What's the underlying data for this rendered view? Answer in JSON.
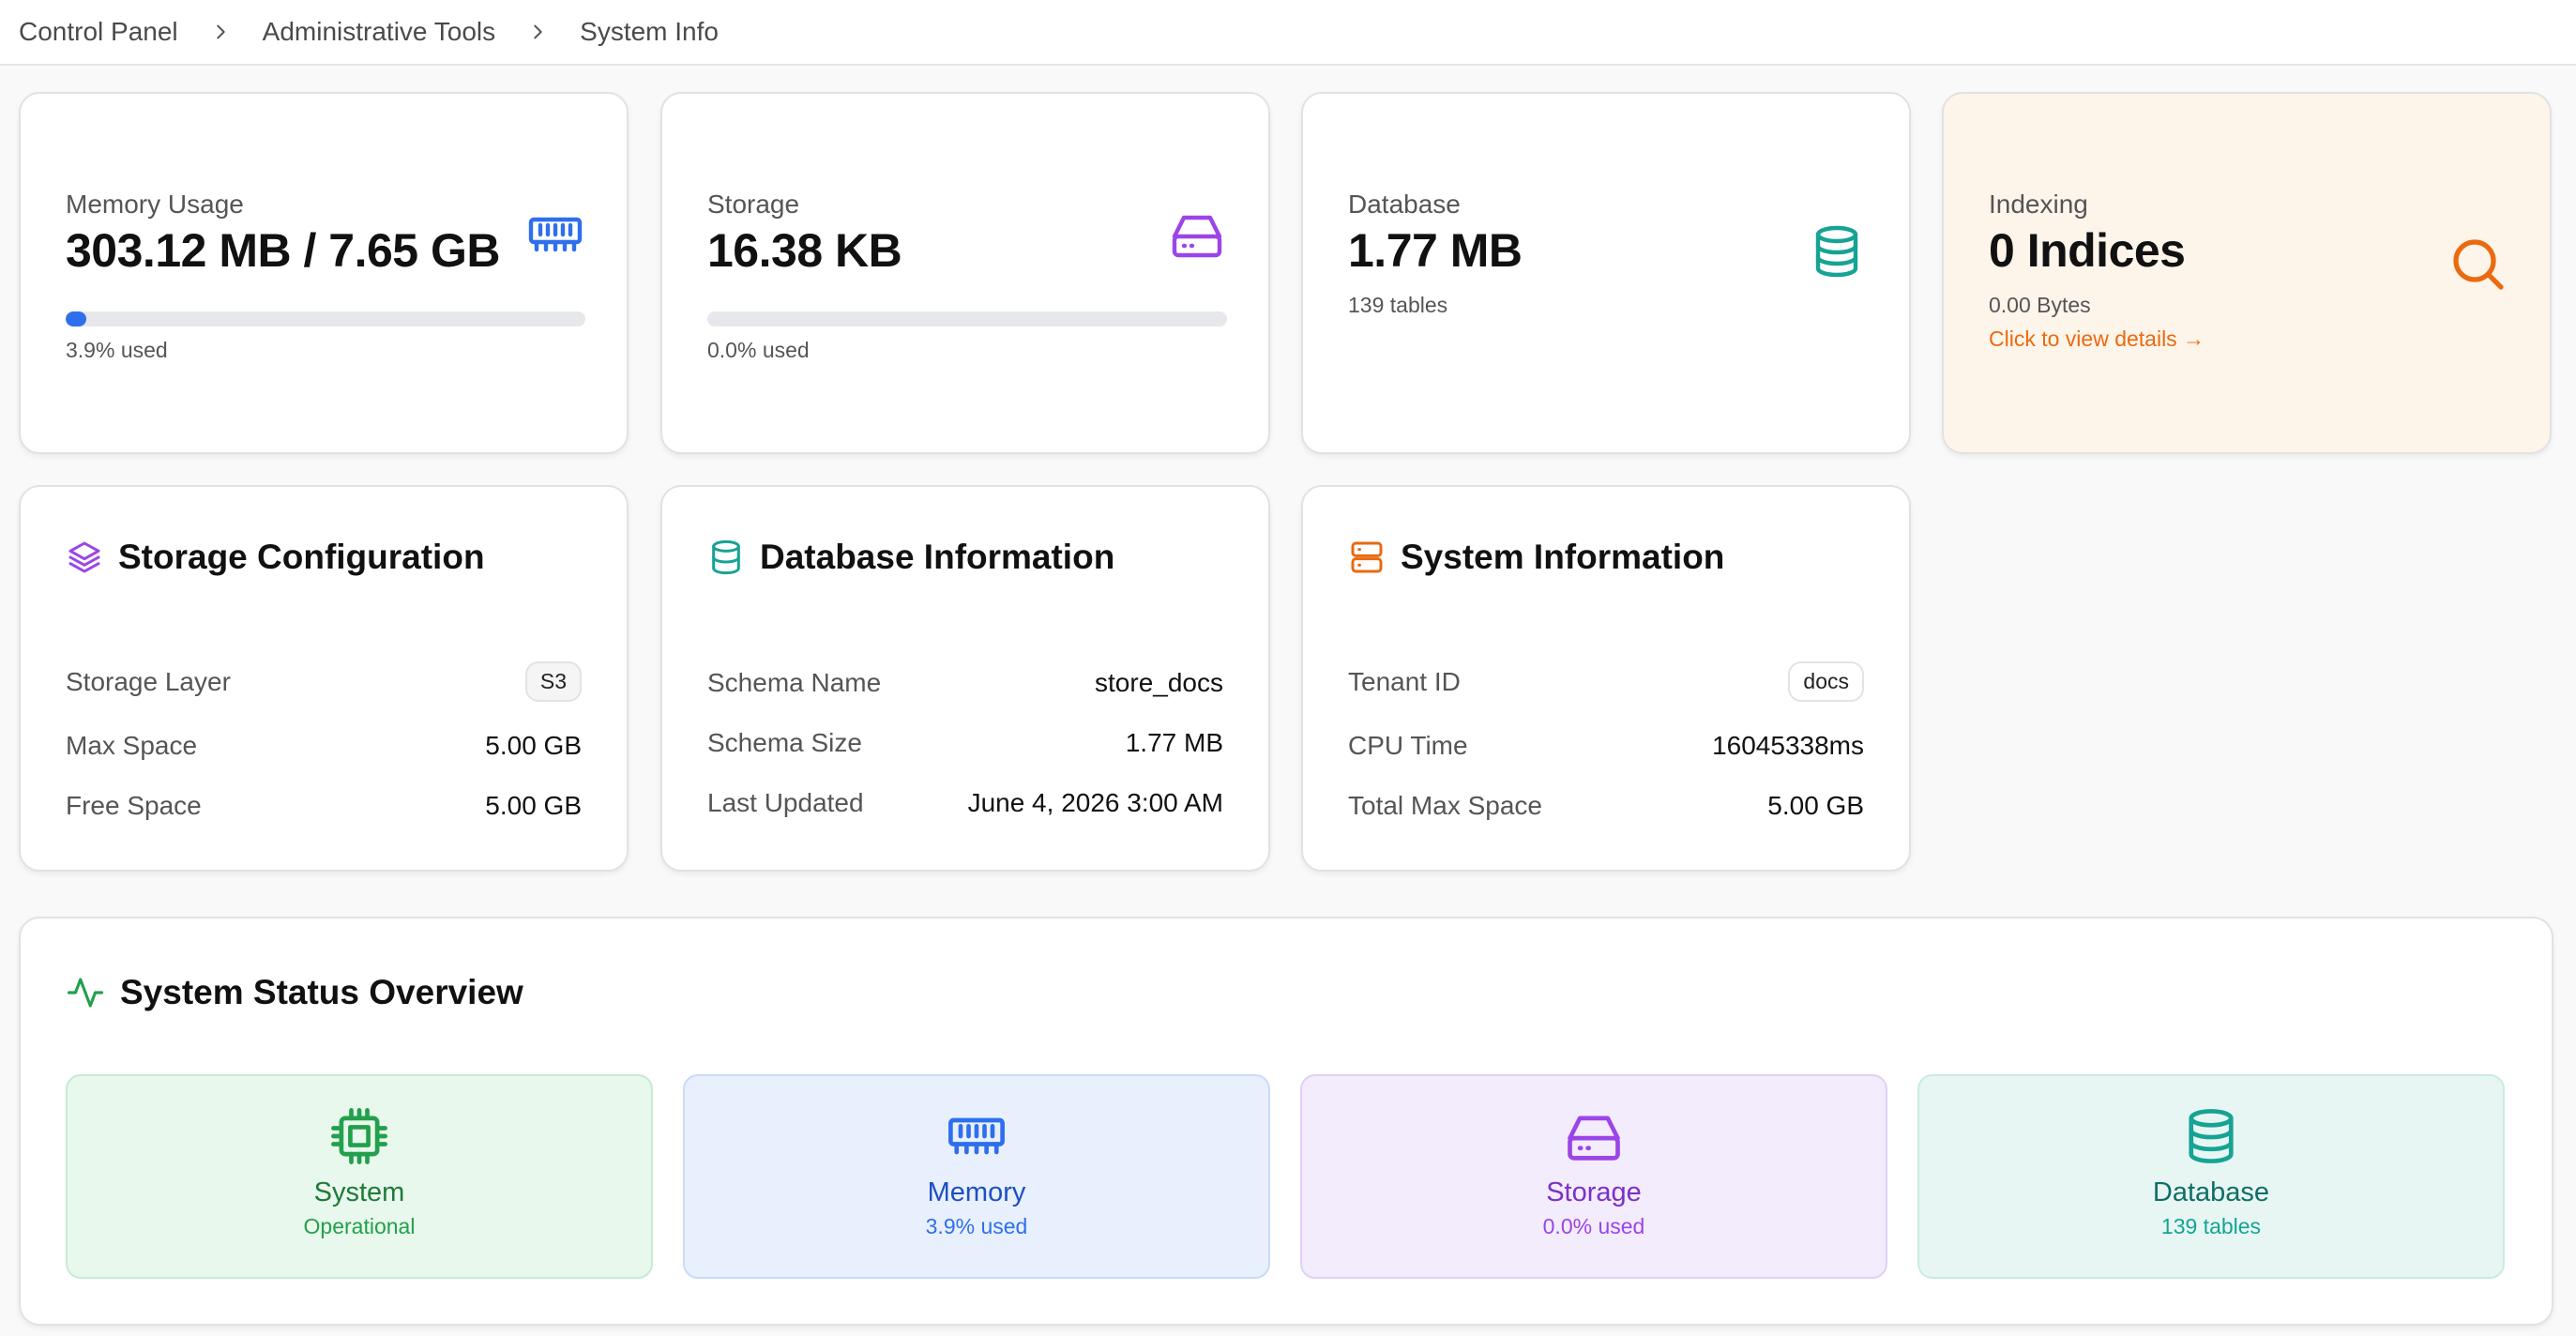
{
  "breadcrumb": [
    "Control Panel",
    "Administrative Tools",
    "System Info"
  ],
  "stats": {
    "memory": {
      "label": "Memory Usage",
      "value": "303.12 MB / 7.65 GB",
      "used_fraction": 0.039,
      "note": "3.9% used",
      "icon": "memory-icon",
      "color": "#2f6fed"
    },
    "storage": {
      "label": "Storage",
      "value": "16.38 KB",
      "used_fraction": 0.0,
      "note": "0.0% used",
      "icon": "hard-drive-icon",
      "color": "#9b45e8"
    },
    "database": {
      "label": "Database",
      "value": "1.77 MB",
      "sub": "139 tables",
      "icon": "database-icon",
      "color": "#16a394"
    },
    "indexing": {
      "label": "Indexing",
      "value": "0 Indices",
      "sub": "0.00 Bytes",
      "link": "Click to view details →",
      "icon": "search-icon",
      "color": "#ea6a0f",
      "background": "#fdf4ea"
    }
  },
  "storage_config": {
    "title": "Storage Configuration",
    "icon": "layers-icon",
    "rows": [
      {
        "key": "Storage Layer",
        "value": "S3"
      },
      {
        "key": "Max Space",
        "value": "5.00 GB"
      },
      {
        "key": "Free Space",
        "value": "5.00 GB"
      }
    ]
  },
  "database_info": {
    "title": "Database Information",
    "icon": "database-icon",
    "rows": [
      {
        "key": "Schema Name",
        "value": "store_docs"
      },
      {
        "key": "Schema Size",
        "value": "1.77 MB"
      },
      {
        "key": "Last Updated",
        "value": "June 4, 2026 3:00 AM"
      }
    ]
  },
  "system_info": {
    "title": "System Information",
    "icon": "server-icon",
    "rows": [
      {
        "key": "Tenant ID",
        "value": "docs"
      },
      {
        "key": "CPU Time",
        "value": "16045338ms"
      },
      {
        "key": "Total Max Space",
        "value": "5.00 GB"
      }
    ]
  },
  "overview": {
    "title": "System Status Overview",
    "icon": "activity-icon",
    "tiles": [
      {
        "name": "System",
        "note": "Operational",
        "icon": "cpu-icon",
        "fg": "#1f7a3a",
        "accent": "#22a04b",
        "bg": "#e8f8ec",
        "border": "#c7ebd1"
      },
      {
        "name": "Memory",
        "note": "3.9% used",
        "icon": "memory-icon",
        "fg": "#1d4fc4",
        "accent": "#2f6fed",
        "bg": "#e8f0fd",
        "border": "#c8dbf8"
      },
      {
        "name": "Storage",
        "note": "0.0% used",
        "icon": "hard-drive-icon",
        "fg": "#7c2fc9",
        "accent": "#9b45e8",
        "bg": "#f3ecfd",
        "border": "#e0d0f6"
      },
      {
        "name": "Database",
        "note": "139 tables",
        "icon": "database-icon",
        "fg": "#0f6e67",
        "accent": "#16a394",
        "bg": "#e7f6f3",
        "border": "#c9ebe4"
      }
    ]
  }
}
